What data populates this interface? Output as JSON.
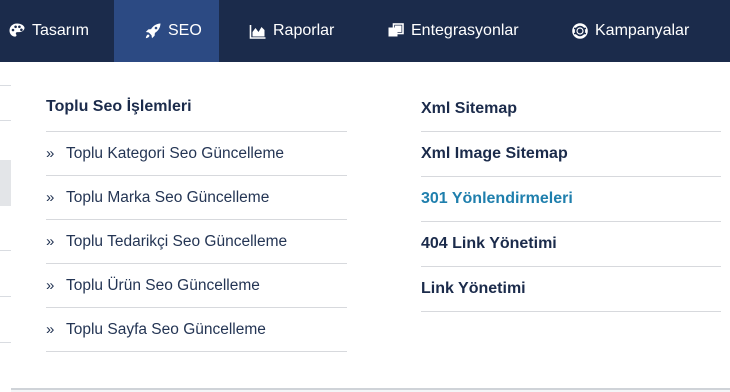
{
  "nav": {
    "items": [
      {
        "label": "Tasarım",
        "icon": "palette-icon"
      },
      {
        "label": "SEO",
        "icon": "rocket-icon",
        "active": true
      },
      {
        "label": "Raporlar",
        "icon": "area-chart-icon"
      },
      {
        "label": "Entegrasyonlar",
        "icon": "clone-icon"
      },
      {
        "label": "Kampanyalar",
        "icon": "life-ring-icon"
      }
    ],
    "background": "#1b2b4b",
    "active_background": "#2c4a83"
  },
  "dropdown": {
    "left": {
      "title": "Toplu Seo İşlemleri",
      "items": [
        "Toplu Kategori Seo Güncelleme",
        "Toplu Marka Seo Güncelleme",
        "Toplu Tedarikçi Seo Güncelleme",
        "Toplu Ürün Seo Güncelleme",
        "Toplu Sayfa Seo Güncelleme"
      ],
      "bullet": "»"
    },
    "right": {
      "items": [
        "Xml Sitemap",
        "Xml Image Sitemap",
        "301 Yönlendirmeleri",
        "404 Link Yönetimi",
        "Link Yönetimi"
      ],
      "highlight_color": "#1f7fad"
    }
  }
}
